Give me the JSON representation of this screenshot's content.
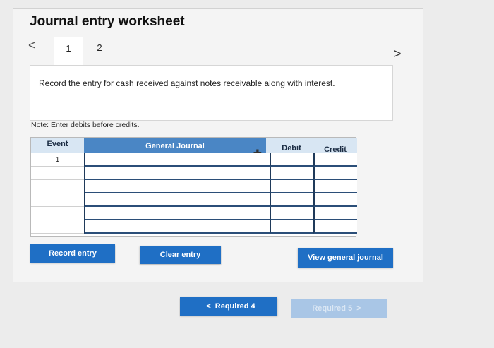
{
  "page": {
    "title": "Journal entry worksheet",
    "nav_prev": "<",
    "nav_next": ">",
    "tabs": [
      {
        "label": "1",
        "active": true
      },
      {
        "label": "2",
        "active": false
      }
    ],
    "question": "Record the entry for cash received against notes receivable along with interest.",
    "note": "Note: Enter debits before credits."
  },
  "table": {
    "headers": {
      "event": "Event",
      "journal": "General Journal",
      "debit": "Debit",
      "credit": "Credit"
    },
    "rows": [
      {
        "event": "1",
        "account": "",
        "debit": "",
        "credit": ""
      },
      {
        "event": "",
        "account": "",
        "debit": "",
        "credit": ""
      },
      {
        "event": "",
        "account": "",
        "debit": "",
        "credit": ""
      },
      {
        "event": "",
        "account": "",
        "debit": "",
        "credit": ""
      },
      {
        "event": "",
        "account": "",
        "debit": "",
        "credit": ""
      },
      {
        "event": "",
        "account": "",
        "debit": "",
        "credit": ""
      }
    ],
    "add_row_icon": "plus-icon"
  },
  "buttons": {
    "record": "Record entry",
    "clear": "Clear entry",
    "view": "View general journal"
  },
  "footer": {
    "prev_chevron": "<",
    "prev_label": "Required 4",
    "next_label": "Required 5",
    "next_chevron": ">"
  },
  "colors": {
    "accent": "#1f6fc5",
    "header_active": "#4a86c5",
    "header_bg": "#d8e6f3",
    "disabled": "#a9c6e6"
  }
}
